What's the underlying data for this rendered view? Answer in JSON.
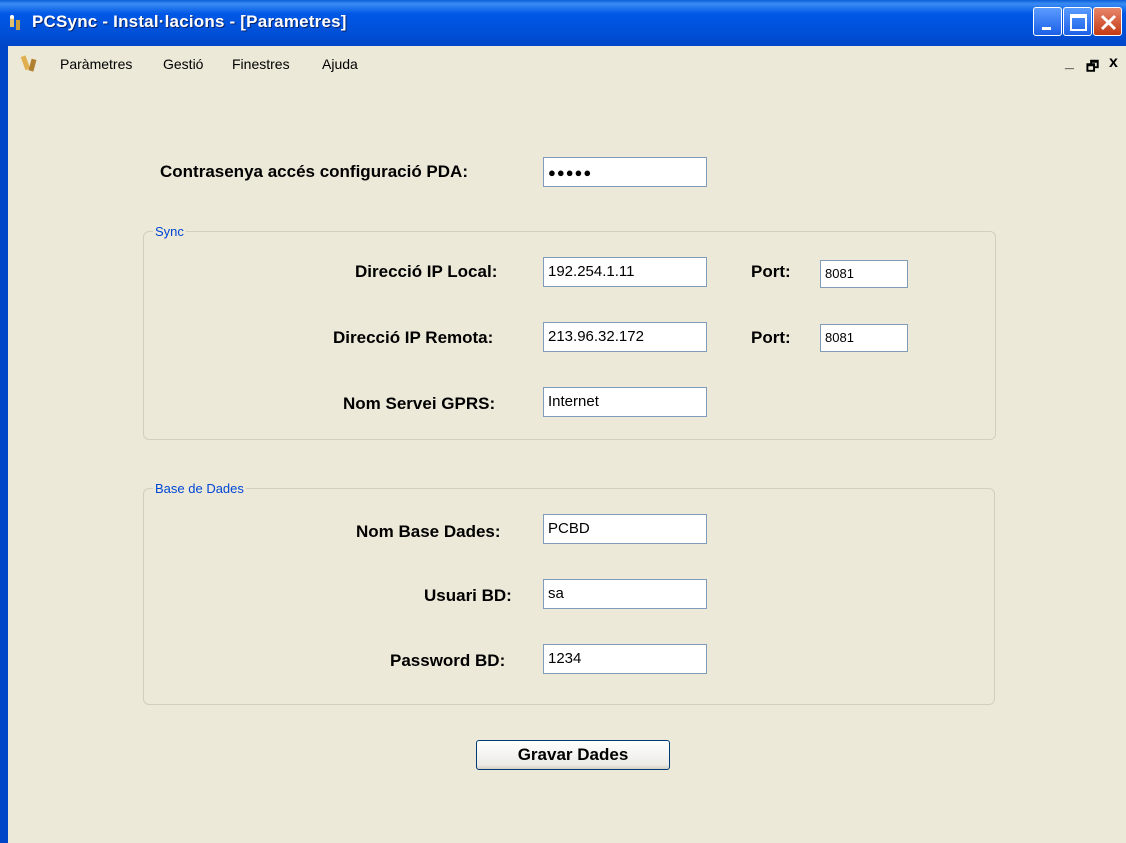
{
  "window": {
    "title": "PCSync - Instal·lacions - [Parametres]"
  },
  "menu": {
    "items": [
      "Paràmetres",
      "Gestió",
      "Finestres",
      "Ajuda"
    ],
    "mdi_controls": [
      "_",
      "🗗",
      "x"
    ]
  },
  "form": {
    "pda_password_label": "Contrasenya accés configuració PDA:",
    "pda_password_value": "●●●●●",
    "sync": {
      "legend": "Sync",
      "local_ip_label": "Direcció IP Local:",
      "local_ip_value": "192.254.1.11",
      "local_port_label": "Port:",
      "local_port_value": "8081",
      "remote_ip_label": "Direcció IP Remota:",
      "remote_ip_value": "213.96.32.172",
      "remote_port_label": "Port:",
      "remote_port_value": "8081",
      "gprs_label": "Nom Servei GPRS:",
      "gprs_value": "Internet"
    },
    "database": {
      "legend": "Base de Dades",
      "db_name_label": "Nom Base Dades:",
      "db_name_value": "PCBD",
      "db_user_label": "Usuari BD:",
      "db_user_value": "sa",
      "db_password_label": "Password BD:",
      "db_password_value": "1234"
    },
    "save_button": "Gravar Dades"
  },
  "colors": {
    "titlebar": "#0058e6",
    "face": "#ece9d8",
    "legend": "#0046d5"
  }
}
